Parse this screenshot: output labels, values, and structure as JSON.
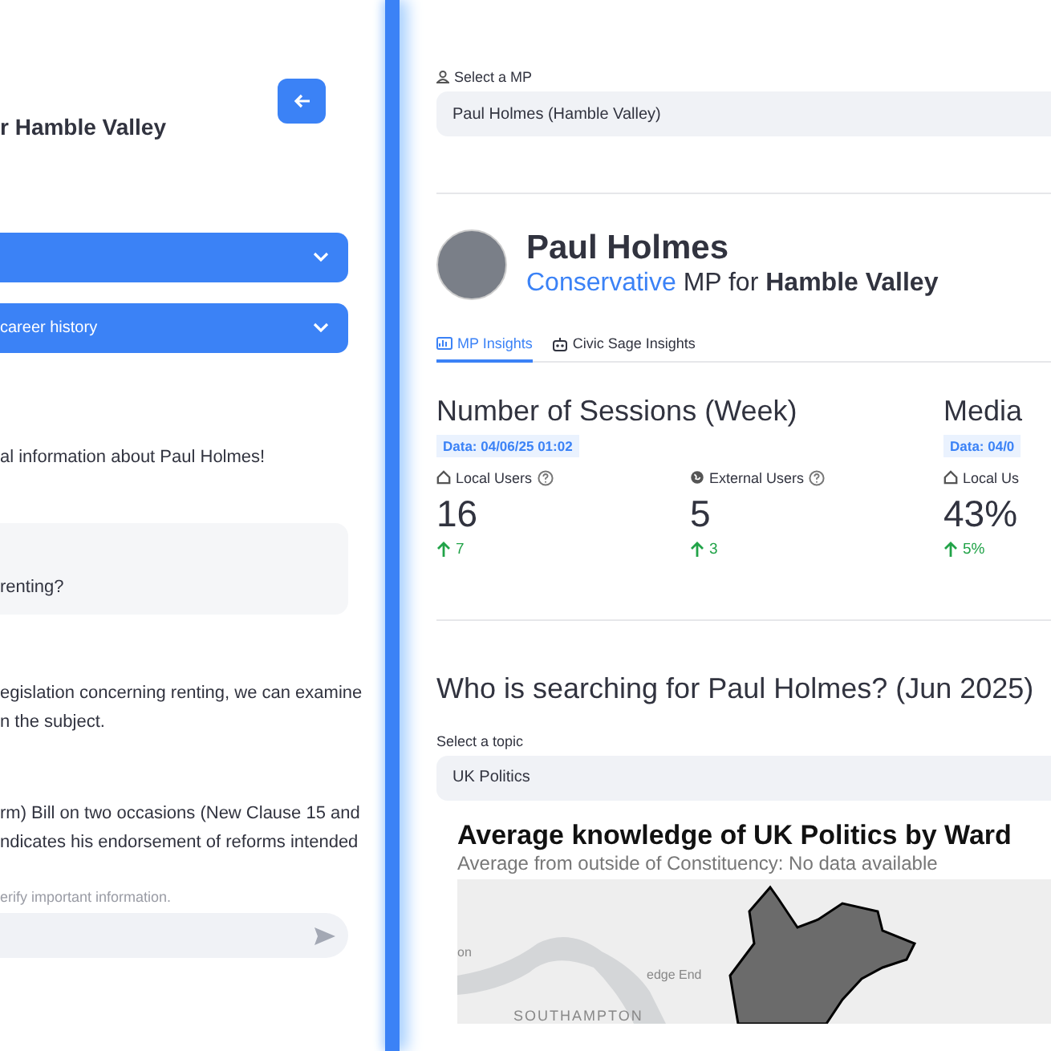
{
  "sidebar": {
    "heading": "r Hamble Valley",
    "expanders": [
      {
        "expanded": false
      },
      {
        "label": "career history",
        "expanded": false
      }
    ],
    "chat": {
      "intro": "al information about Paul Holmes!",
      "user_message": "renting?",
      "assistant_paragraphs": [
        [
          "egislation concerning renting, we can examine",
          "n the subject."
        ],
        [
          "rm) Bill on two occasions (New Clause 15 and",
          "ndicates his endorsement of reforms intended"
        ]
      ],
      "disclaimer": "erify important information."
    }
  },
  "main": {
    "select_mp": {
      "label": "Select a MP",
      "value": "Paul Holmes (Hamble Valley)"
    },
    "mp": {
      "name": "Paul Holmes",
      "party": "Conservative",
      "role": "MP for",
      "constituency": "Hamble Valley"
    },
    "tabs": [
      {
        "label": "MP Insights",
        "selected": true
      },
      {
        "label": "Civic Sage Insights",
        "selected": false
      }
    ],
    "metric_groups": [
      {
        "title": "Number of Sessions (Week)",
        "badge": "Data: 04/06/25 01:02",
        "metrics": [
          {
            "kind": "local",
            "label": "Local Users",
            "help": true,
            "value": "16",
            "delta": "7"
          },
          {
            "kind": "external",
            "label": "External Users",
            "help": true,
            "value": "5",
            "delta": "3"
          }
        ]
      },
      {
        "title": "Media",
        "badge": "Data: 04/0",
        "metrics": [
          {
            "kind": "local",
            "label": "Local Us",
            "help": false,
            "value": "43%",
            "delta": "5%"
          }
        ]
      }
    ],
    "search": {
      "heading": "Who is searching for Paul Holmes? (Jun 2025)",
      "topic_label": "Select a topic",
      "topic_value": "UK Politics",
      "map": {
        "title": "Average knowledge of UK Politics by Ward",
        "subtitle": "Average from outside of Constituency: No data available",
        "labels": [
          "on",
          "edge End",
          "SOUTHAMPTON"
        ]
      }
    }
  }
}
